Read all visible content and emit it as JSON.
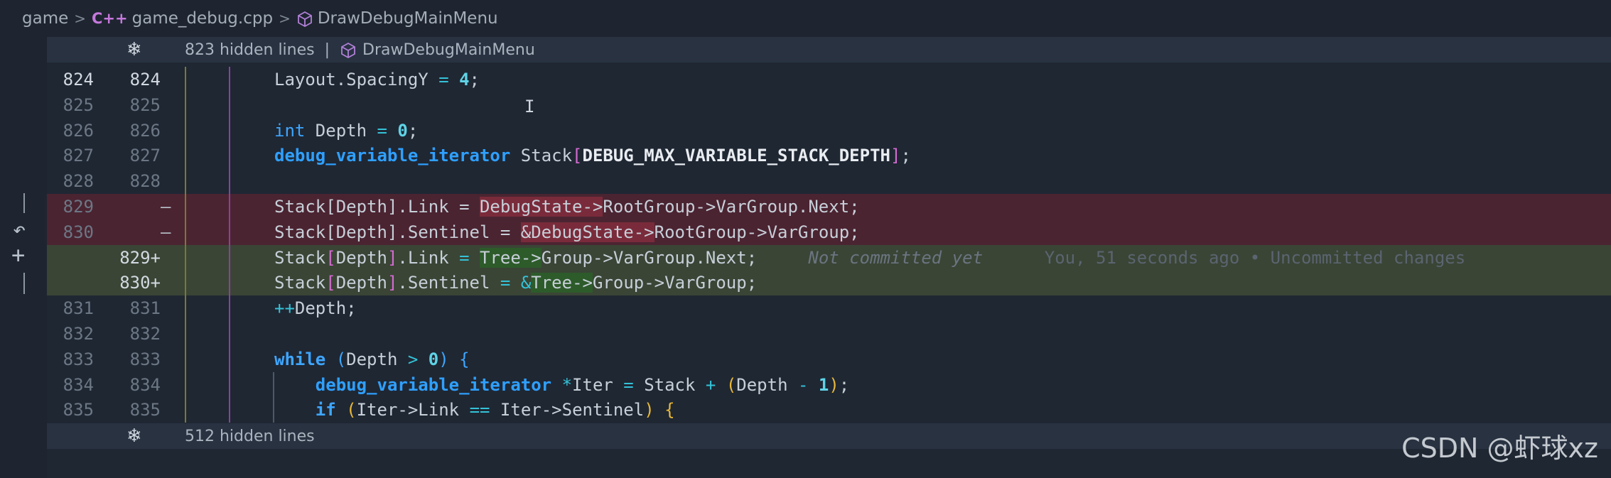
{
  "breadcrumb": {
    "folder": "game",
    "file_icon": "C++",
    "file": "game_debug.cpp",
    "symbol": "DrawDebugMainMenu"
  },
  "hidden_top": {
    "text": "823 hidden lines",
    "separator": "|",
    "symbol": "DrawDebugMainMenu"
  },
  "hidden_bottom": {
    "text": "512 hidden lines"
  },
  "lines": [
    {
      "old": "824",
      "new": "824",
      "type": "ctx"
    },
    {
      "old": "825",
      "new": "825",
      "type": "ctx"
    },
    {
      "old": "826",
      "new": "826",
      "type": "ctx"
    },
    {
      "old": "827",
      "new": "827",
      "type": "ctx"
    },
    {
      "old": "828",
      "new": "828",
      "type": "ctx"
    },
    {
      "old": "829",
      "new": "",
      "type": "del",
      "marker": "—"
    },
    {
      "old": "830",
      "new": "",
      "type": "del",
      "marker": "—"
    },
    {
      "old": "",
      "new": "829+",
      "type": "add"
    },
    {
      "old": "",
      "new": "830+",
      "type": "add"
    },
    {
      "old": "831",
      "new": "831",
      "type": "ctx"
    },
    {
      "old": "832",
      "new": "832",
      "type": "ctx"
    },
    {
      "old": "833",
      "new": "833",
      "type": "ctx"
    },
    {
      "old": "834",
      "new": "834",
      "type": "ctx"
    },
    {
      "old": "835",
      "new": "835",
      "type": "ctx"
    }
  ],
  "code": {
    "l824_a": "Layout.SpacingY ",
    "l824_eq": "=",
    "l824_num": "4",
    "l824_end": ";",
    "l826_kw": "int",
    "l826_a": " Depth ",
    "l826_eq": "=",
    "l826_num": "0",
    "l826_end": ";",
    "l827_type": "debug_variable_iterator",
    "l827_a": " Stack",
    "l827_lb": "[",
    "l827_macro": "DEBUG_MAX_VARIABLE_STACK_DEPTH",
    "l827_rb": "]",
    "l827_end": ";",
    "l829": "Stack[Depth].Link = ",
    "l829_hl": "DebugState->",
    "l829_b": "RootGroup->VarGroup.Next;",
    "l830": "Stack[Depth].Sentinel = ",
    "l830_hl": "&DebugState->",
    "l830_b": "RootGroup->VarGroup;",
    "a829_a": "Stack",
    "a829_lb": "[",
    "a829_b": "Depth",
    "a829_rb": "]",
    "a829_c": ".Link ",
    "a829_eq": "=",
    "a829_sp": " ",
    "a829_hl": "Tree->",
    "a829_d": "Group->VarGroup.Next;",
    "a830_a": "Stack",
    "a830_lb": "[",
    "a830_b": "Depth",
    "a830_rb": "]",
    "a830_c": ".Sentinel ",
    "a830_eq": "=",
    "a830_sp": " ",
    "a830_amp": "&",
    "a830_hl": "Tree->",
    "a830_d": "Group->VarGroup;",
    "l831_op": "++",
    "l831_a": "Depth;",
    "l833_kw": "while",
    "l833_sp": " ",
    "l833_lp": "(",
    "l833_a": "Depth ",
    "l833_gt": ">",
    "l833_sp2": " ",
    "l833_num": "0",
    "l833_rp": ")",
    "l833_sp3": " ",
    "l833_lb": "{",
    "l834_type": "debug_variable_iterator",
    "l834_sp": " ",
    "l834_star": "*",
    "l834_a": "Iter ",
    "l834_eq": "=",
    "l834_b": " Stack ",
    "l834_plus": "+",
    "l834_sp2": " ",
    "l834_lp": "(",
    "l834_c": "Depth ",
    "l834_minus": "-",
    "l834_sp3": " ",
    "l834_num": "1",
    "l834_rp": ")",
    "l834_end": ";",
    "l835_kw": "if",
    "l835_sp": " ",
    "l835_lp": "(",
    "l835_a": "Iter->Link ",
    "l835_eq": "==",
    "l835_b": " Iter->Sentinel",
    "l835_rp": ")",
    "l835_sp2": " ",
    "l835_lb": "{"
  },
  "blame": {
    "status": "Not committed yet",
    "info": "You, 51 seconds ago • Uncommitted changes"
  },
  "icons": {
    "fold": "snowflake-icon",
    "symbol": "cube-icon",
    "revert": "revert-icon",
    "add": "plus-icon",
    "cursor": "ibeam-cursor-icon"
  },
  "watermark": "CSDN @虾球xz",
  "colors": {
    "deleted_bg": "#4b2431",
    "added_bg": "#3a4536",
    "keyword": "#3ea6ff"
  }
}
